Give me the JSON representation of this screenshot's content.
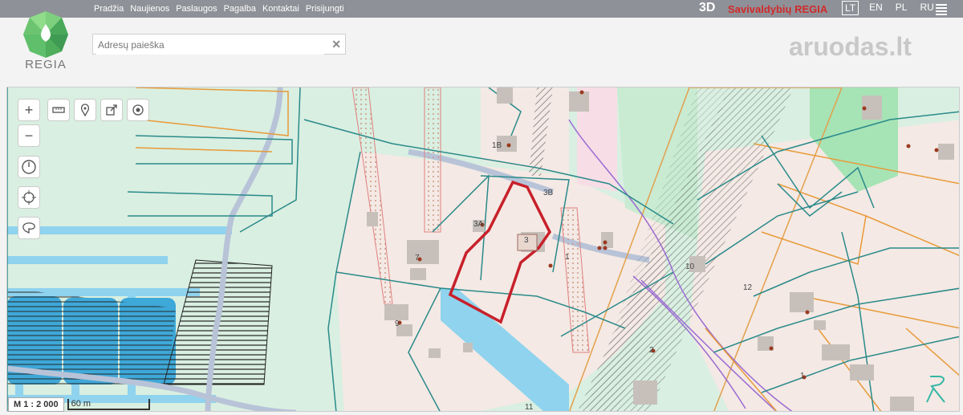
{
  "nav": {
    "items": [
      "Pradžia",
      "Naujienos",
      "Paslaugos",
      "Pagalba",
      "Kontaktai",
      "Prisijungti"
    ]
  },
  "header": {
    "mode_3d": "3D",
    "site_name": "Savivaldybių REGIA",
    "languages": [
      "LT",
      "EN",
      "PL",
      "RU"
    ],
    "active_language": "LT"
  },
  "logo": {
    "text": "REGIA"
  },
  "search": {
    "placeholder": "Adresų paieška",
    "value": ""
  },
  "watermark": {
    "text": "aruodas",
    "suffix": ".lt"
  },
  "map": {
    "labels": [
      "1B",
      "3B",
      "3A",
      "3",
      "1",
      "7",
      "9",
      "10",
      "12",
      "11",
      "2",
      "1"
    ],
    "scale_ratio": "M 1 : 2 000",
    "scale_bar": "60 m"
  },
  "colors": {
    "topbar": "#8f9198",
    "accent_red": "#d12a2a",
    "parcel_outline": "#c8202a",
    "water": "#8fd3ee",
    "land": "#d9efe1",
    "building_area": "#f4e9e4"
  }
}
